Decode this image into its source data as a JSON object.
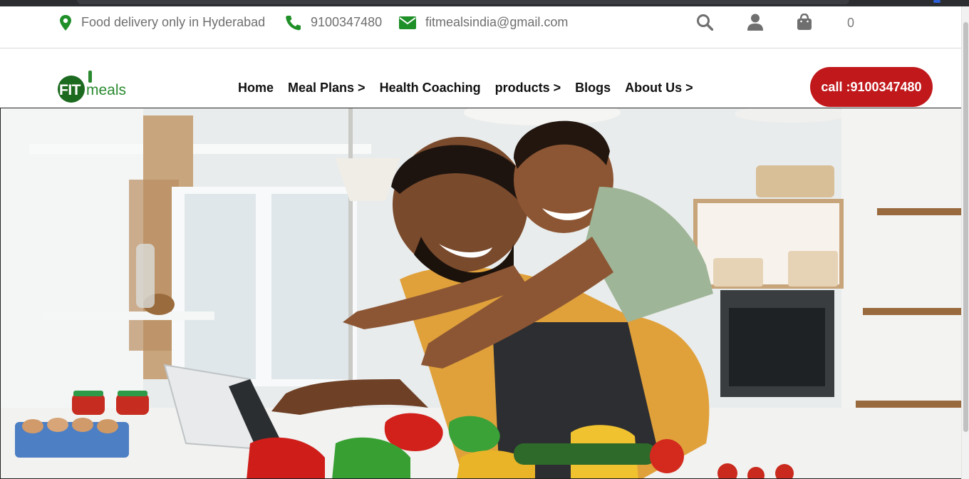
{
  "topbar": {
    "location_text": "Food delivery only in Hyderabad",
    "phone_text": "9100347480",
    "email_text": "fitmealsindia@gmail.com",
    "cart_count": "0",
    "icons": [
      "map-pin-icon",
      "phone-icon",
      "envelope-icon",
      "search-icon",
      "user-icon",
      "shopping-bag-icon"
    ]
  },
  "header": {
    "logo": {
      "fit": "FIT",
      "meals": "meals"
    },
    "nav": [
      {
        "label": "Home"
      },
      {
        "label": "Meal Plans >"
      },
      {
        "label": "Health Coaching"
      },
      {
        "label": "products >"
      },
      {
        "label": "Blogs"
      },
      {
        "label": "About Us >"
      }
    ],
    "call_button": "call :9100347480"
  },
  "hero": {
    "image": "family-cooking-photo"
  },
  "colors": {
    "brand_green": "#1c6a1f",
    "icon_green": "#1f8f28",
    "call_red": "#c0181b",
    "text_gray": "#6f6f6f"
  }
}
